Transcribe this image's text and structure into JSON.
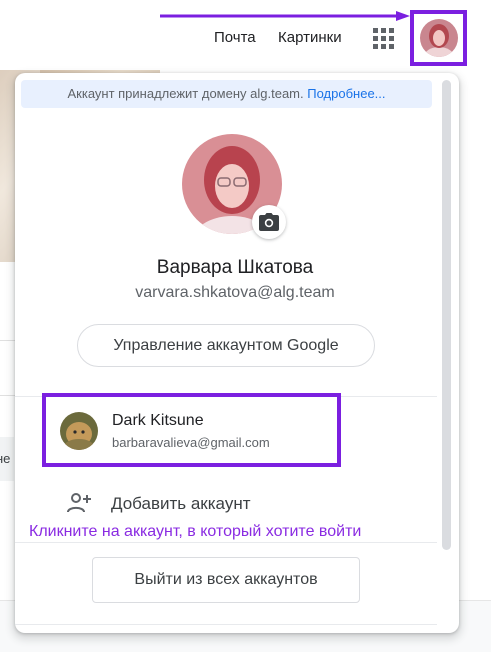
{
  "header": {
    "links": [
      "Почта",
      "Картинки"
    ],
    "apps_icon": "apps-grid-icon",
    "highlight_color": "#7b1fe0"
  },
  "background": {
    "chip_text": "не"
  },
  "popup": {
    "domain_notice": "Аккаунт принадлежит домену alg.team.",
    "domain_notice_link": "Подробнее...",
    "user_name": "Варвара Шкатова",
    "user_email": "varvara.shkatova@alg.team",
    "camera_icon": "camera-icon",
    "manage_button": "Управление аккаунтом Google",
    "other_account": {
      "name": "Dark Kitsune",
      "email": "barbaravalieva@gmail.com"
    },
    "add_account": {
      "icon": "person-add-icon",
      "label": "Добавить аккаунт"
    },
    "hint": "Кликните на аккаунт, в который хотите войти",
    "hint_color": "#8a2be2",
    "sign_out_button": "Выйти из всех аккаунтов"
  }
}
